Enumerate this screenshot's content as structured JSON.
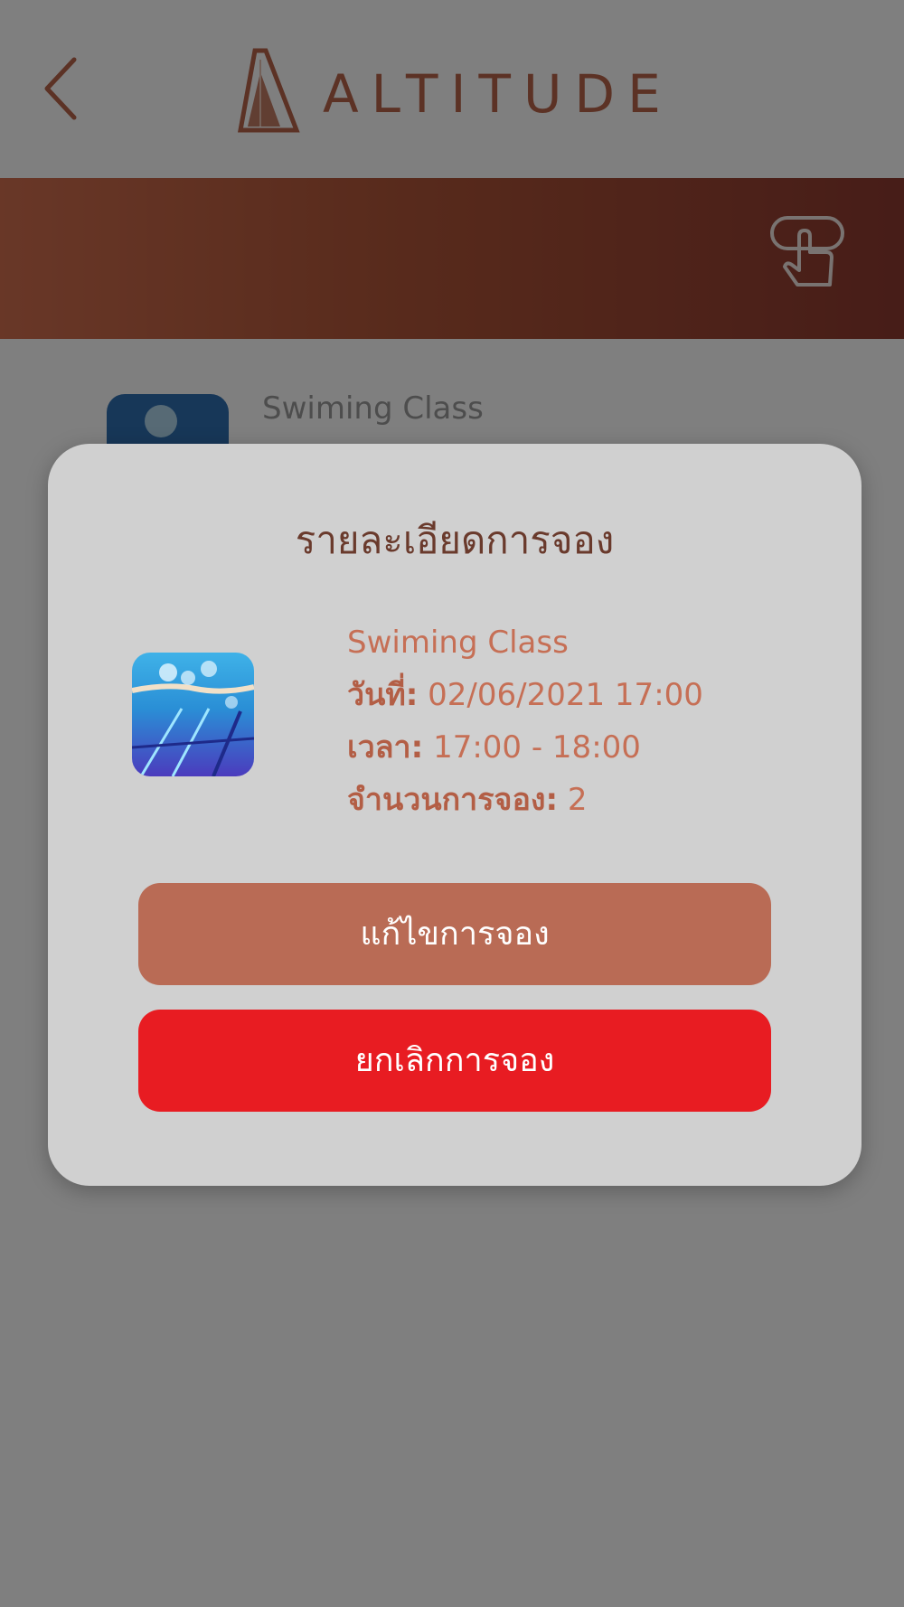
{
  "header": {
    "brand": "ALTITUDE"
  },
  "icons": {
    "back": "chevron-left-icon",
    "touch": "hand-tap-icon"
  },
  "background_list": {
    "item_title": "Swiming Class"
  },
  "modal": {
    "title": "รายละเอียดการจอง",
    "class_name": "Swiming Class",
    "date_label": "วันที่:",
    "date_value": "02/06/2021 17:00",
    "time_label": "เวลา:",
    "time_value": "17:00 - 18:00",
    "count_label": "จำนวนการจอง:",
    "count_value": "2",
    "edit_button": "แก้ไขการจอง",
    "cancel_button": "ยกเลิกการจอง"
  },
  "colors": {
    "accent": "#b9654a",
    "banner_start": "#d26f4f",
    "banner_end": "#8e3a30",
    "edit_button": "#b96b55",
    "cancel_button": "#e81c22",
    "modal_bg": "#d0d0d0"
  }
}
